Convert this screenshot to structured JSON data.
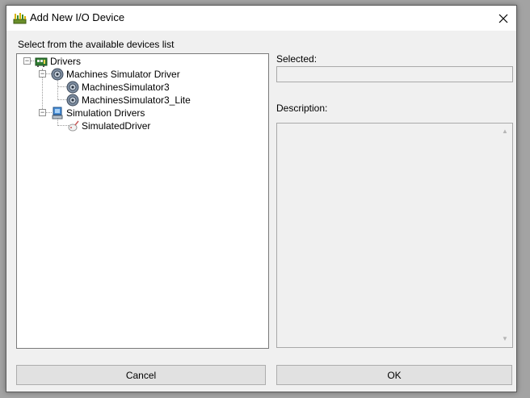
{
  "window": {
    "title": "Add New I/O Device",
    "close_glyph": "✕"
  },
  "tree": {
    "heading": "Select from the available devices list",
    "root": {
      "label": "Drivers",
      "icon": "drivers-icon",
      "expanded": true
    },
    "groups": [
      {
        "label": "Machines Simulator Driver",
        "icon": "gear-icon",
        "expanded": true,
        "children": [
          {
            "label": "MachinesSimulator3",
            "icon": "gear-icon"
          },
          {
            "label": "MachinesSimulator3_Lite",
            "icon": "gear-icon"
          }
        ]
      },
      {
        "label": "Simulation Drivers",
        "icon": "computer-icon",
        "expanded": true,
        "children": [
          {
            "label": "SimulatedDriver",
            "icon": "plug-icon"
          }
        ]
      }
    ]
  },
  "details": {
    "selected_label": "Selected:",
    "selected_value": "",
    "description_label": "Description:",
    "description_value": ""
  },
  "buttons": {
    "cancel": "Cancel",
    "ok": "OK"
  },
  "colors": {
    "window_bg": "#f0f0f0",
    "titlebar_bg": "#ffffff",
    "button_bg": "#e1e1e1"
  }
}
